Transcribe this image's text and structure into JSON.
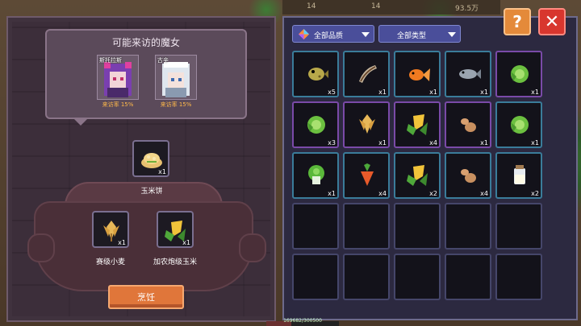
{
  "topbar": {
    "resource_a": "14",
    "resource_b": "14",
    "gold": "93.5万"
  },
  "hp_text": "169682/300500",
  "bubble": {
    "title": "可能来访的魔女"
  },
  "witches": [
    {
      "name": "斯托拉斯",
      "rate": "来访率 15%"
    },
    {
      "name": "古辛",
      "rate": "来访率 15%"
    }
  ],
  "recipe": {
    "result": {
      "label": "玉米饼",
      "count": "x1"
    },
    "ingredients": [
      {
        "label": "赛级小麦",
        "count": "x1"
      },
      {
        "label": "加农炮级玉米",
        "count": "x1"
      }
    ],
    "cook_label": "烹饪"
  },
  "filters": {
    "quality": "全部品质",
    "type": "全部类型"
  },
  "inventory": [
    {
      "icon": "pufferfish-icon",
      "count": "x5",
      "border": "cyan"
    },
    {
      "icon": "eel-icon",
      "count": "x1",
      "border": "cyan"
    },
    {
      "icon": "goldfish-icon",
      "count": "x1",
      "border": "cyan"
    },
    {
      "icon": "grey-fish-icon",
      "count": "x1",
      "border": "cyan"
    },
    {
      "icon": "cabbage-icon",
      "count": "x1",
      "border": "purple"
    },
    {
      "icon": "cabbage-icon",
      "count": "x3",
      "border": "purple"
    },
    {
      "icon": "wheat-icon",
      "count": "x1",
      "border": "purple"
    },
    {
      "icon": "corn-icon",
      "count": "x4",
      "border": "purple"
    },
    {
      "icon": "potato-icon",
      "count": "x1",
      "border": "purple"
    },
    {
      "icon": "cabbage-icon",
      "count": "x1",
      "border": "cyan"
    },
    {
      "icon": "bok-choy-icon",
      "count": "x1",
      "border": "cyan"
    },
    {
      "icon": "carrot-icon",
      "count": "x4",
      "border": "cyan"
    },
    {
      "icon": "corn-icon",
      "count": "x2",
      "border": "cyan"
    },
    {
      "icon": "potato-icon",
      "count": "x4",
      "border": "cyan"
    },
    {
      "icon": "milk-jar-icon",
      "count": "x2",
      "border": "cyan"
    },
    {
      "icon": "",
      "count": "",
      "border": "plain"
    },
    {
      "icon": "",
      "count": "",
      "border": "plain"
    },
    {
      "icon": "",
      "count": "",
      "border": "plain"
    },
    {
      "icon": "",
      "count": "",
      "border": "plain"
    },
    {
      "icon": "",
      "count": "",
      "border": "plain"
    },
    {
      "icon": "",
      "count": "",
      "border": "plain"
    },
    {
      "icon": "",
      "count": "",
      "border": "plain"
    },
    {
      "icon": "",
      "count": "",
      "border": "plain"
    },
    {
      "icon": "",
      "count": "",
      "border": "plain"
    },
    {
      "icon": "",
      "count": "",
      "border": "plain"
    }
  ],
  "help_label": "?",
  "close_label": "✕"
}
